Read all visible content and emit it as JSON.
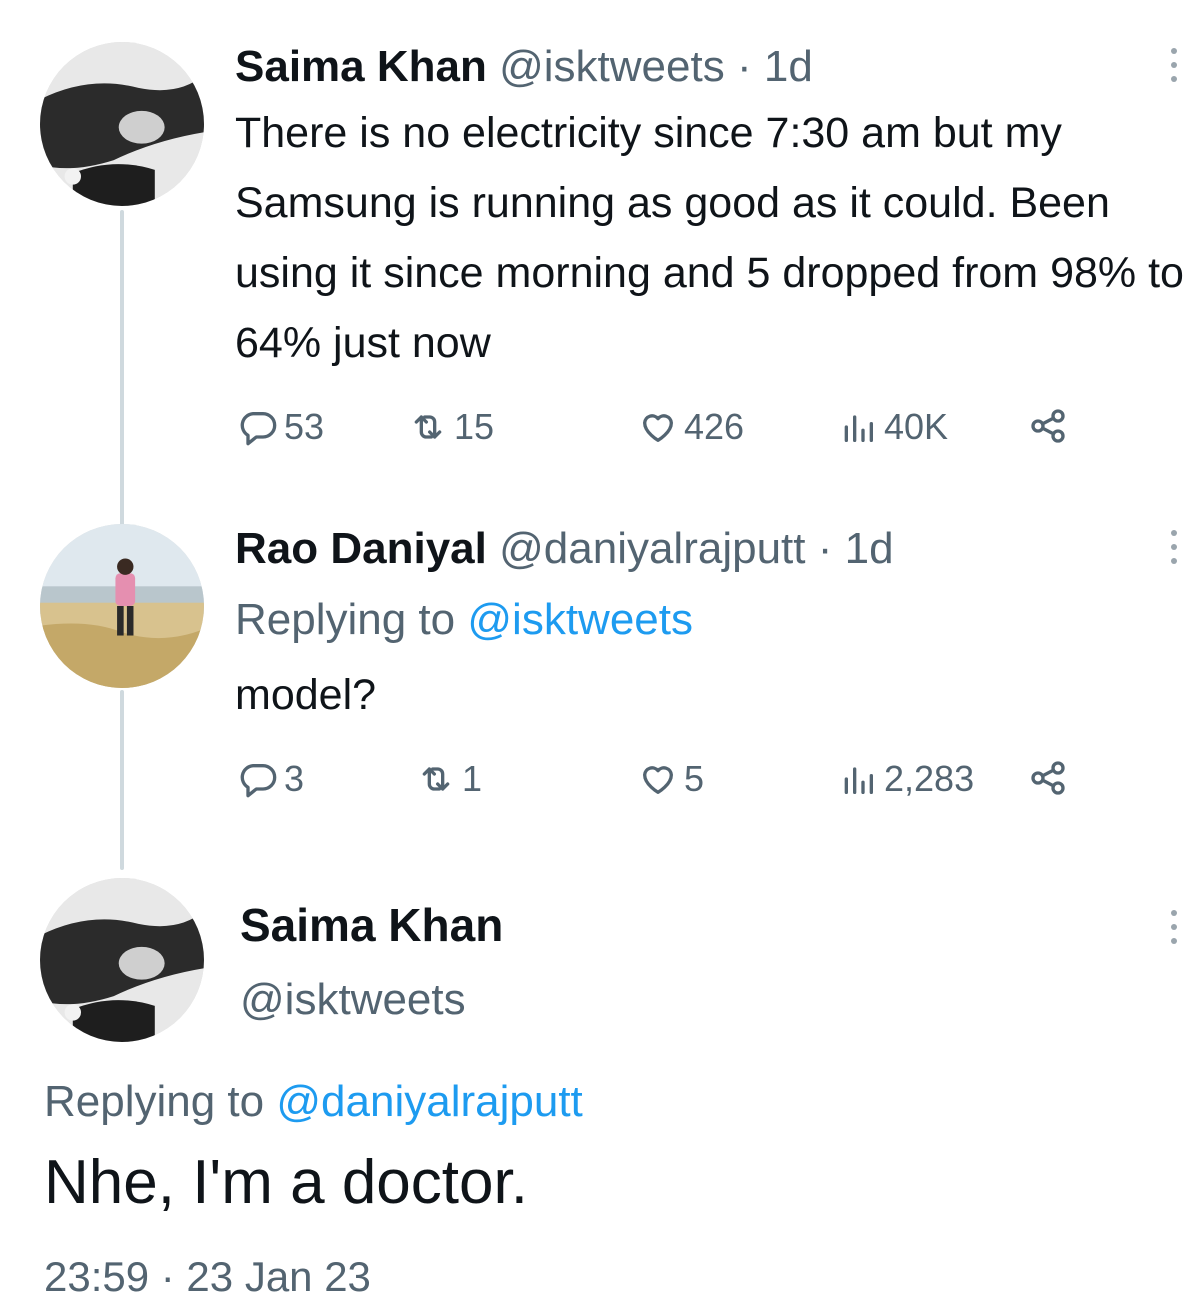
{
  "thread": [
    {
      "display_name": "Saima Khan",
      "handle": "@isktweets",
      "separator": "·",
      "time": "1d",
      "text": "There is no electricity since 7:30 am but my Samsung is running as good as it could. Been using it since morning and 5 dropped from 98% to 64% just now",
      "stats": {
        "replies": "53",
        "retweets": "15",
        "likes": "426",
        "views": "40K"
      }
    },
    {
      "display_name": "Rao Daniyal",
      "handle": "@daniyalrajputt",
      "separator": "·",
      "time": "1d",
      "replying_prefix": "Replying to",
      "replying_to": "@isktweets",
      "text": "model?",
      "stats": {
        "replies": "3",
        "retweets": "1",
        "likes": "5",
        "views": "2,283"
      }
    }
  ],
  "focused": {
    "display_name": "Saima Khan",
    "handle": "@isktweets",
    "replying_prefix": "Replying to",
    "replying_to": "@daniyalrajputt",
    "text": "Nhe, I'm a doctor.",
    "timestamp": "23:59 · 23 Jan 23"
  },
  "icons": {
    "reply": "reply-icon",
    "retweet": "retweet-icon",
    "like": "heart-icon",
    "views": "views-icon",
    "share": "share-icon",
    "more": "more-vertical-icon"
  },
  "colors": {
    "text": "#0f1419",
    "muted": "#536471",
    "link": "#1d9bf0",
    "thread_line": "#cfd9de"
  }
}
